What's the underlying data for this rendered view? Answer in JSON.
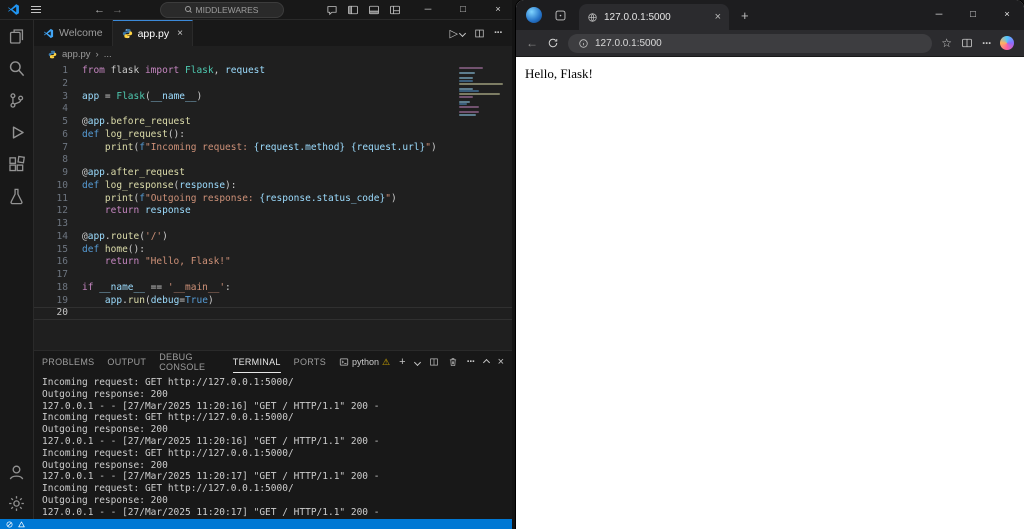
{
  "vscode": {
    "titlebar": {
      "search": "MIDDLEWARES"
    },
    "tabs": {
      "welcome": "Welcome",
      "app": "app.py"
    },
    "breadcrumb": {
      "file": "app.py",
      "sep": "›",
      "more": "..."
    },
    "editor": {
      "active_line": 20,
      "token_colors": {
        "kw": "#C586C0",
        "defkw": "#569CD6",
        "cls": "#4EC9B0",
        "fn": "#DCDCAA",
        "var": "#9CDCFE",
        "str": "#CE9178",
        "num": "#B5CEA8",
        "const": "#569CD6",
        "interp": "#9CDCFE",
        "txt": "#CCCCCC"
      },
      "lines": [
        [
          [
            "kw",
            "from"
          ],
          [
            "txt",
            " flask "
          ],
          [
            "kw",
            "import"
          ],
          [
            "txt",
            " "
          ],
          [
            "cls",
            "Flask"
          ],
          [
            "txt",
            ", "
          ],
          [
            "var",
            "request"
          ]
        ],
        [],
        [
          [
            "var",
            "app"
          ],
          [
            "txt",
            " = "
          ],
          [
            "cls",
            "Flask"
          ],
          [
            "txt",
            "("
          ],
          [
            "var",
            "__name__"
          ],
          [
            "txt",
            ")"
          ]
        ],
        [],
        [
          [
            "txt",
            "@"
          ],
          [
            "var",
            "app"
          ],
          [
            "txt",
            "."
          ],
          [
            "fn",
            "before_request"
          ]
        ],
        [
          [
            "defkw",
            "def"
          ],
          [
            "txt",
            " "
          ],
          [
            "fn",
            "log_request"
          ],
          [
            "txt",
            "():"
          ]
        ],
        [
          [
            "txt",
            "    "
          ],
          [
            "fn",
            "print"
          ],
          [
            "txt",
            "("
          ],
          [
            "defkw",
            "f"
          ],
          [
            "str",
            "\"Incoming request: "
          ],
          [
            "interp",
            "{request.method}"
          ],
          [
            "str",
            " "
          ],
          [
            "interp",
            "{request.url}"
          ],
          [
            "str",
            "\""
          ],
          [
            "txt",
            ")"
          ]
        ],
        [],
        [
          [
            "txt",
            "@"
          ],
          [
            "var",
            "app"
          ],
          [
            "txt",
            "."
          ],
          [
            "fn",
            "after_request"
          ]
        ],
        [
          [
            "defkw",
            "def"
          ],
          [
            "txt",
            " "
          ],
          [
            "fn",
            "log_response"
          ],
          [
            "txt",
            "("
          ],
          [
            "var",
            "response"
          ],
          [
            "txt",
            "):"
          ]
        ],
        [
          [
            "txt",
            "    "
          ],
          [
            "fn",
            "print"
          ],
          [
            "txt",
            "("
          ],
          [
            "defkw",
            "f"
          ],
          [
            "str",
            "\"Outgoing response: "
          ],
          [
            "interp",
            "{response.status_code}"
          ],
          [
            "str",
            "\""
          ],
          [
            "txt",
            ")"
          ]
        ],
        [
          [
            "txt",
            "    "
          ],
          [
            "kw",
            "return"
          ],
          [
            "txt",
            " "
          ],
          [
            "var",
            "response"
          ]
        ],
        [],
        [
          [
            "txt",
            "@"
          ],
          [
            "var",
            "app"
          ],
          [
            "txt",
            "."
          ],
          [
            "fn",
            "route"
          ],
          [
            "txt",
            "("
          ],
          [
            "str",
            "'/'"
          ],
          [
            "txt",
            ")"
          ]
        ],
        [
          [
            "defkw",
            "def"
          ],
          [
            "txt",
            " "
          ],
          [
            "fn",
            "home"
          ],
          [
            "txt",
            "():"
          ]
        ],
        [
          [
            "txt",
            "    "
          ],
          [
            "kw",
            "return"
          ],
          [
            "txt",
            " "
          ],
          [
            "str",
            "\"Hello, Flask!\""
          ]
        ],
        [],
        [
          [
            "kw",
            "if"
          ],
          [
            "txt",
            " "
          ],
          [
            "var",
            "__name__"
          ],
          [
            "txt",
            " == "
          ],
          [
            "str",
            "'__main__'"
          ],
          [
            "txt",
            ":"
          ]
        ],
        [
          [
            "txt",
            "    "
          ],
          [
            "var",
            "app"
          ],
          [
            "txt",
            "."
          ],
          [
            "fn",
            "run"
          ],
          [
            "txt",
            "("
          ],
          [
            "var",
            "debug"
          ],
          [
            "txt",
            "="
          ],
          [
            "const",
            "True"
          ],
          [
            "txt",
            ")"
          ]
        ],
        []
      ]
    },
    "panel": {
      "tabs": [
        "PROBLEMS",
        "OUTPUT",
        "DEBUG CONSOLE",
        "TERMINAL",
        "PORTS"
      ],
      "active_tab": "TERMINAL",
      "terminal_profile": "python"
    },
    "terminal_lines": [
      "Incoming request: GET http://127.0.0.1:5000/",
      "Outgoing response: 200",
      "127.0.0.1 - - [27/Mar/2025 11:20:16] \"GET / HTTP/1.1\" 200 -",
      "Incoming request: GET http://127.0.0.1:5000/",
      "Outgoing response: 200",
      "127.0.0.1 - - [27/Mar/2025 11:20:16] \"GET / HTTP/1.1\" 200 -",
      "Incoming request: GET http://127.0.0.1:5000/",
      "Outgoing response: 200",
      "127.0.0.1 - - [27/Mar/2025 11:20:17] \"GET / HTTP/1.1\" 200 -",
      "Incoming request: GET http://127.0.0.1:5000/",
      "Outgoing response: 200",
      "127.0.0.1 - - [27/Mar/2025 11:20:17] \"GET / HTTP/1.1\" 200 -"
    ],
    "statusbar_color": "#0078d4"
  },
  "browser": {
    "tab": {
      "title": "127.0.0.1:5000"
    },
    "toolbar": {
      "address": "127.0.0.1:5000"
    },
    "page": {
      "text": "Hello, Flask!"
    }
  }
}
